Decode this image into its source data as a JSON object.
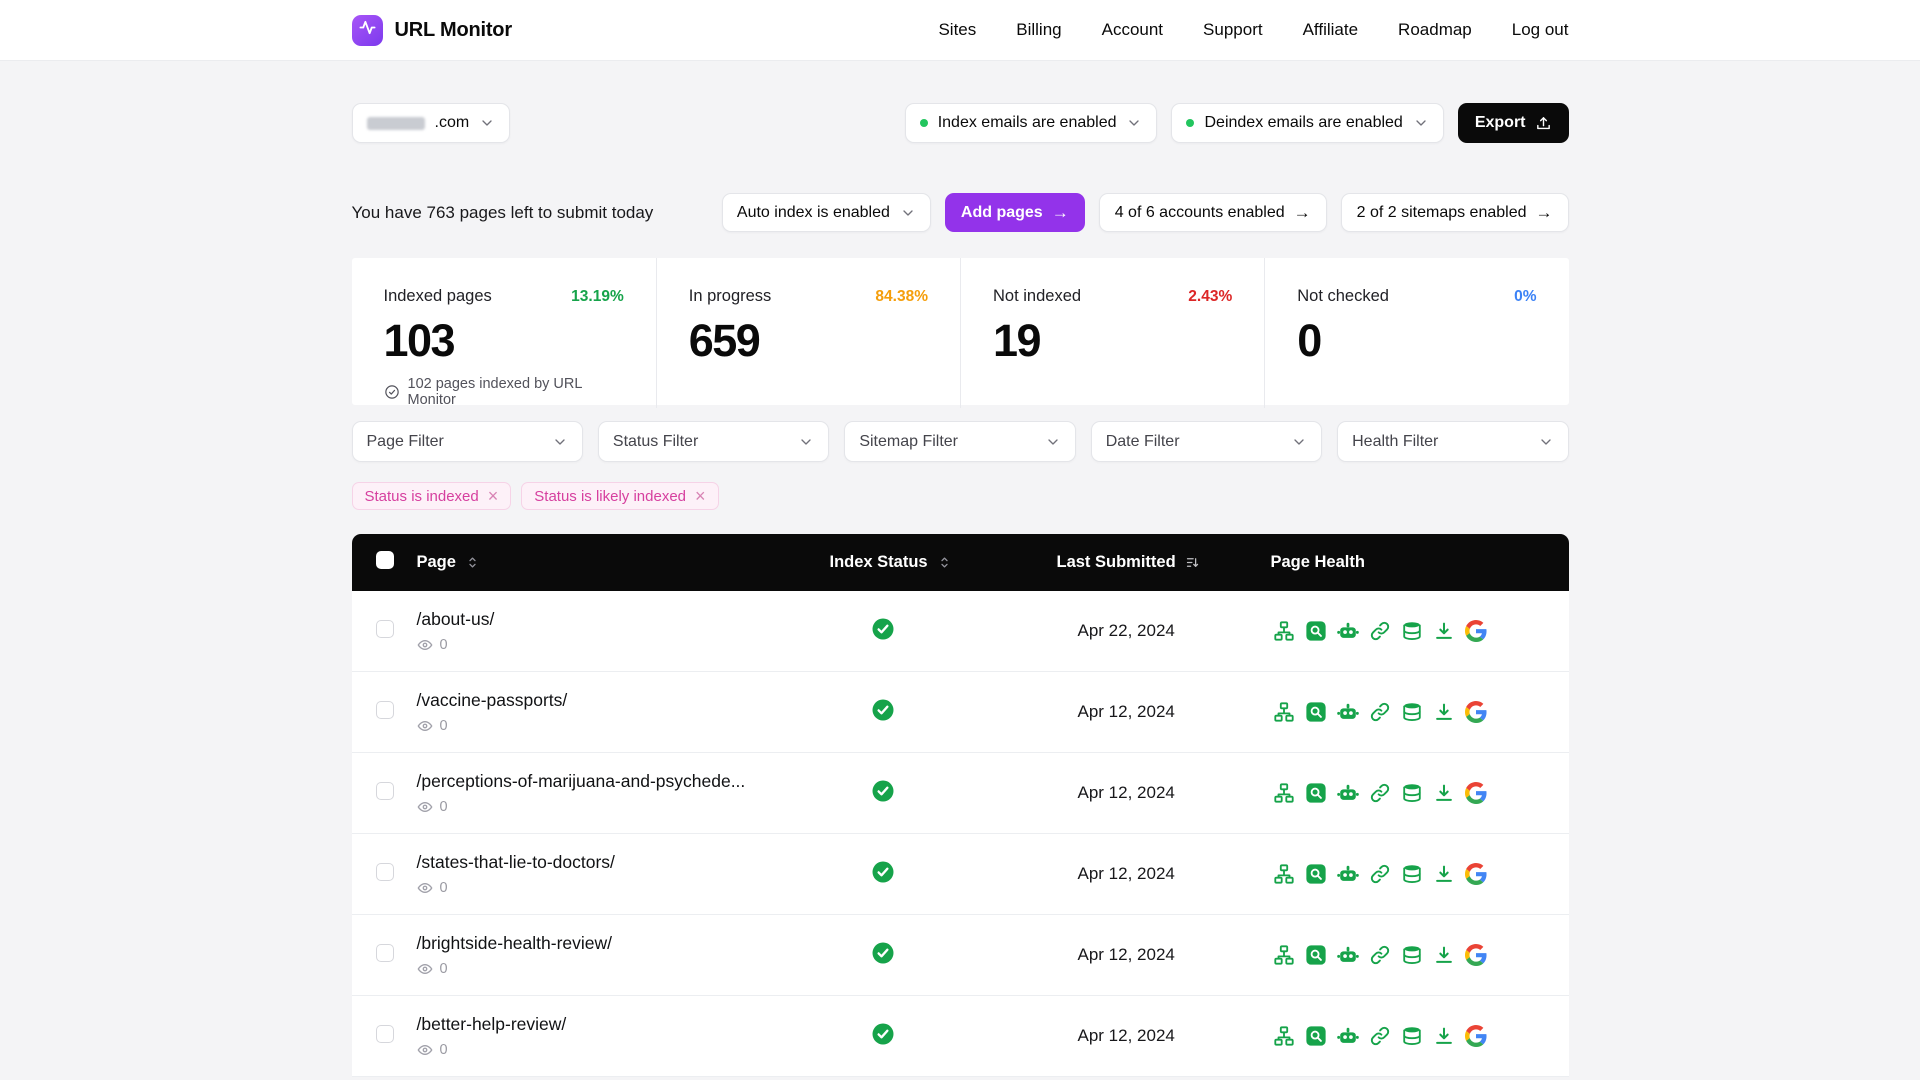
{
  "brand": {
    "name": "URL Monitor"
  },
  "nav": {
    "items": [
      "Sites",
      "Billing",
      "Account",
      "Support",
      "Affiliate",
      "Roadmap",
      "Log out"
    ]
  },
  "icons": {
    "arrow_right": "→",
    "close": "×"
  },
  "toolbar": {
    "domain_suffix": ".com",
    "index_emails_label": "Index emails are enabled",
    "deindex_emails_label": "Deindex emails are enabled",
    "export_label": "Export"
  },
  "submitbar": {
    "quota_text": "You have 763 pages left to submit today",
    "auto_index_label": "Auto index is enabled",
    "add_pages_label": "Add pages",
    "accounts_label": "4 of 6 accounts enabled",
    "sitemaps_label": "2 of 2 sitemaps enabled"
  },
  "stats": [
    {
      "label": "Indexed pages",
      "percent": "13.19%",
      "value": "103",
      "percent_color": "#16a34a",
      "note": "102 pages indexed by URL Monitor"
    },
    {
      "label": "In progress",
      "percent": "84.38%",
      "value": "659",
      "percent_color": "#f59e0b"
    },
    {
      "label": "Not indexed",
      "percent": "2.43%",
      "value": "19",
      "percent_color": "#dc2626"
    },
    {
      "label": "Not checked",
      "percent": "0%",
      "value": "0",
      "percent_color": "#3b82f6"
    }
  ],
  "filters": [
    "Page Filter",
    "Status Filter",
    "Sitemap Filter",
    "Date Filter",
    "Health Filter"
  ],
  "chips": [
    "Status is indexed",
    "Status is likely indexed"
  ],
  "table": {
    "headers": {
      "page": "Page",
      "status": "Index Status",
      "submitted": "Last Submitted",
      "health": "Page Health"
    },
    "health_icons": [
      "sitemap-icon",
      "inspect-icon",
      "robot-icon",
      "link-icon",
      "stack-icon",
      "download-icon",
      "google-icon"
    ],
    "rows": [
      {
        "page": "/about-us/",
        "views": "0",
        "submitted": "Apr 22, 2024"
      },
      {
        "page": "/vaccine-passports/",
        "views": "0",
        "submitted": "Apr 12, 2024"
      },
      {
        "page": "/perceptions-of-marijuana-and-psychede...",
        "views": "0",
        "submitted": "Apr 12, 2024"
      },
      {
        "page": "/states-that-lie-to-doctors/",
        "views": "0",
        "submitted": "Apr 12, 2024"
      },
      {
        "page": "/brightside-health-review/",
        "views": "0",
        "submitted": "Apr 12, 2024"
      },
      {
        "page": "/better-help-review/",
        "views": "0",
        "submitted": "Apr 12, 2024"
      }
    ]
  },
  "colors": {
    "brand_purple": "#8b5cf6",
    "add_pages_purple": "#9333ea",
    "indexed_green": "#16a34a",
    "progress_orange": "#f59e0b",
    "not_indexed_red": "#dc2626",
    "not_checked_blue": "#3b82f6",
    "chip_pink": "#d6409f",
    "table_header_black": "#0a0a0a"
  }
}
